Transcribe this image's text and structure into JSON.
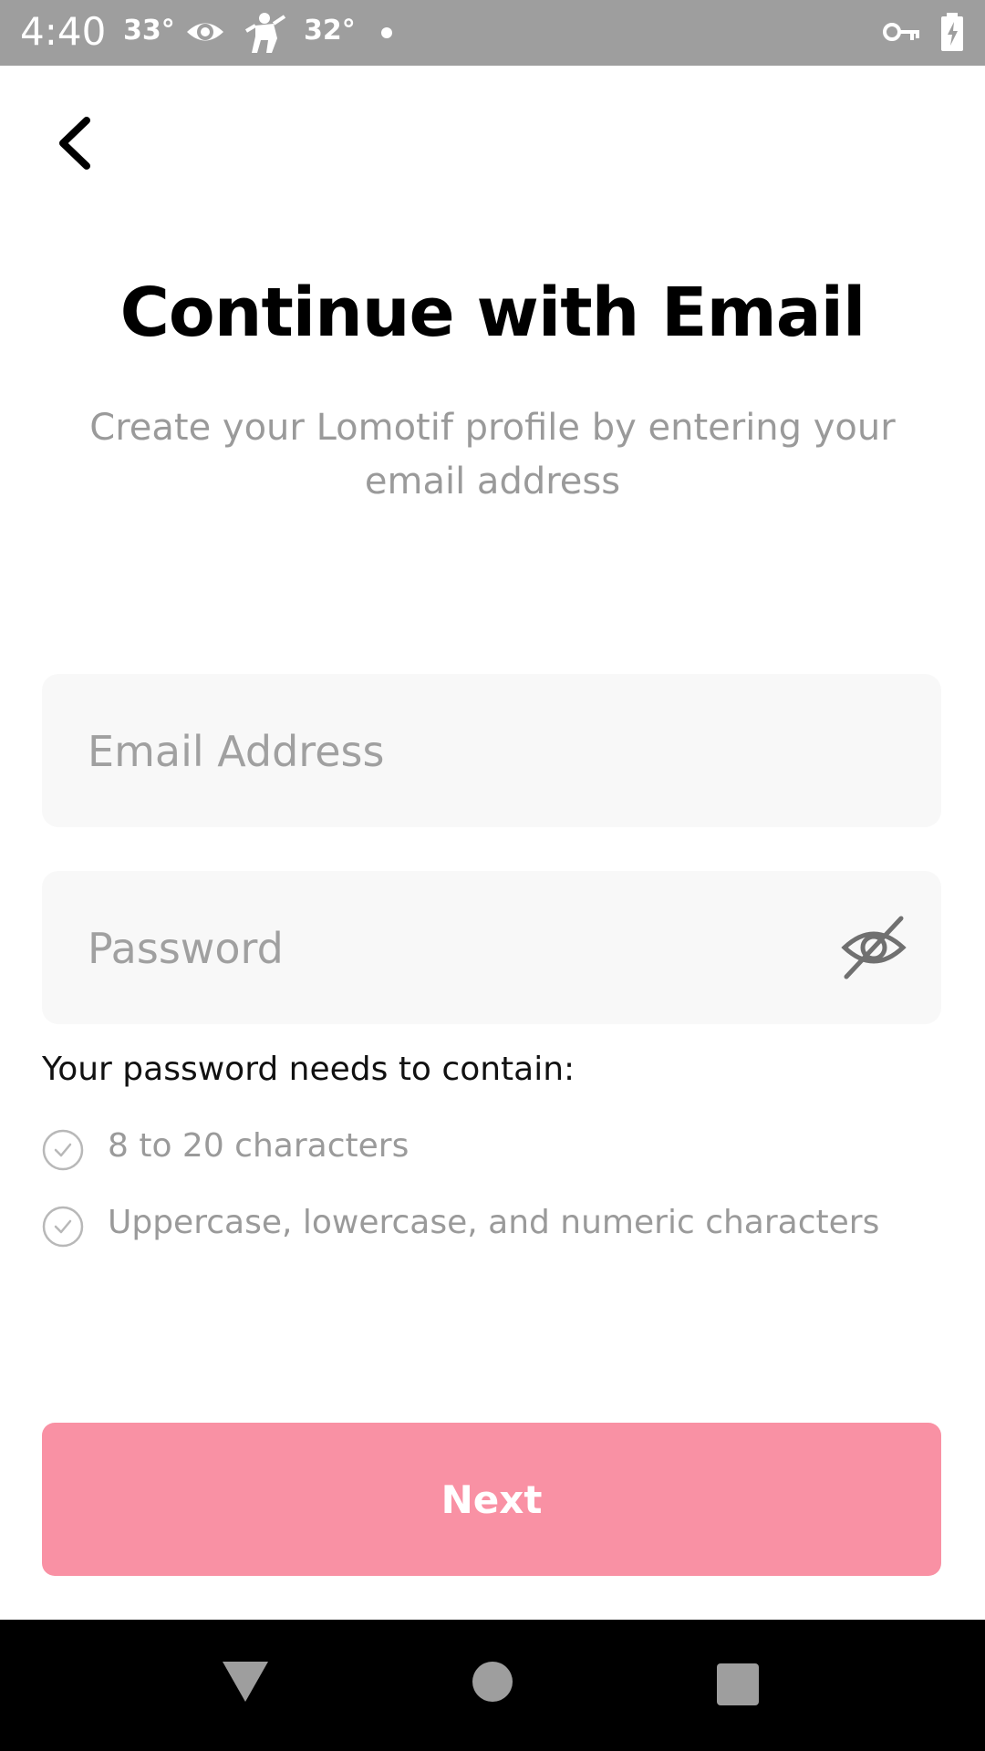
{
  "status_bar": {
    "time": "4:40",
    "temp1": "33°",
    "temp2": "32°",
    "icons": [
      "eye-icon",
      "figure-icon",
      "notification-dot",
      "key-icon",
      "battery-charging-icon"
    ]
  },
  "header": {
    "back_icon": "back-chevron-icon"
  },
  "main": {
    "title": "Continue with Email",
    "subtitle": "Create your Lomotif profile by entering your email address",
    "email_placeholder": "Email Address",
    "email_value": "",
    "password_placeholder": "Password",
    "password_value": "",
    "password_toggle_icon": "eye-off-icon",
    "rules_heading": "Your password needs to contain:",
    "rules": [
      {
        "label": "8 to 20 characters",
        "icon": "check-circle-icon"
      },
      {
        "label": "Uppercase, lowercase, and numeric characters",
        "icon": "check-circle-icon"
      }
    ],
    "next_label": "Next"
  },
  "colors": {
    "accent": "#f991a4",
    "status_bar_bg": "#9e9e9e",
    "field_bg": "#f8f8f8",
    "muted_text": "#9a9a9a"
  },
  "nav_bar": {
    "icons": [
      "nav-back-icon",
      "nav-home-icon",
      "nav-recents-icon"
    ]
  }
}
